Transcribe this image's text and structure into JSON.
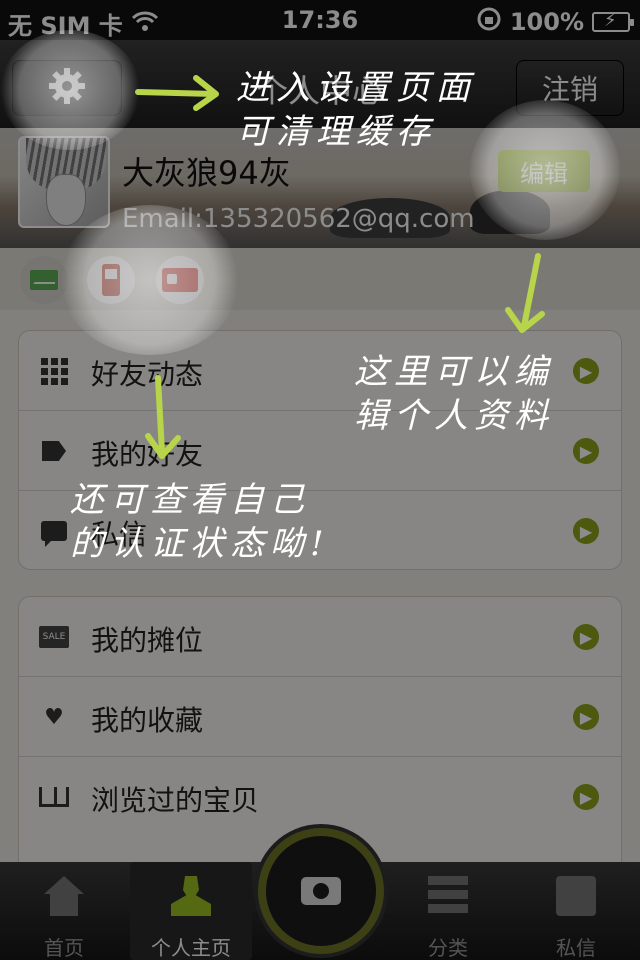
{
  "status_bar": {
    "carrier": "无 SIM 卡",
    "time": "17:36",
    "battery": "100%"
  },
  "nav": {
    "title": "个人中心",
    "logout_label": "注销"
  },
  "profile": {
    "username": "大灰狼94灰",
    "email": "Email:135320562@qq.com",
    "edit_label": "编辑"
  },
  "menu_group_1": [
    {
      "label": "好友动态",
      "icon": "grid-icon"
    },
    {
      "label": "我的好友",
      "icon": "tag-icon"
    },
    {
      "label": "私信",
      "icon": "chat-icon"
    }
  ],
  "menu_group_2": [
    {
      "label": "我的摊位",
      "icon": "sale-icon"
    },
    {
      "label": "我的收藏",
      "icon": "heart-icon"
    },
    {
      "label": "浏览过的宝贝",
      "icon": "book-icon"
    }
  ],
  "tabs": [
    {
      "label": "首页",
      "icon": "home-icon"
    },
    {
      "label": "个人主页",
      "icon": "person-icon"
    },
    {
      "label": "分类",
      "icon": "list-icon"
    },
    {
      "label": "私信",
      "icon": "message-icon"
    }
  ],
  "hints": {
    "settings": "进入设置页面\n可清理缓存",
    "edit": "这里可以编\n辑个人资料",
    "certification": "还可查看自己\n的认证状态呦!"
  },
  "colors": {
    "accent_green": "#8aa31b",
    "edit_button": "#9cbf24",
    "hint_arrow": "#b8d44a"
  }
}
